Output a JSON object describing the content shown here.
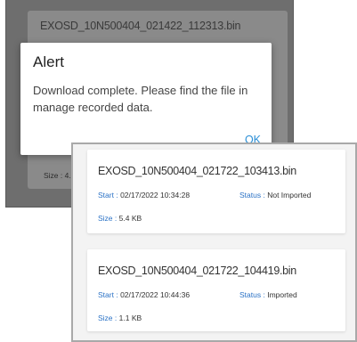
{
  "back_screen": {
    "file_title": "EXOSD_10N500404_021422_112313.bin",
    "size_partial": "Size : 4."
  },
  "alert": {
    "title": "Alert",
    "message": "Download complete. Please find the file in manage recorded data.",
    "ok_label": "OK"
  },
  "files": [
    {
      "name": "EXOSD_10N500404_021722_103413.bin",
      "start_label": "Start :",
      "start_value": "02/17/2022 10:34:28",
      "status_label": "Status :",
      "status_value": "Not Imported",
      "size_label": "Size :",
      "size_value": "5.4 KB"
    },
    {
      "name": "EXOSD_10N500404_021722_104419.bin",
      "start_label": "Start :",
      "start_value": "02/17/2022 10:44:36",
      "status_label": "Status :",
      "status_value": "Imported",
      "size_label": "Size :",
      "size_value": "1.1 KB"
    }
  ],
  "colors": {
    "accent_label": "#2b72c6",
    "ok_button": "#2b8fd6",
    "dim_overlay": "#6e6e6e"
  }
}
